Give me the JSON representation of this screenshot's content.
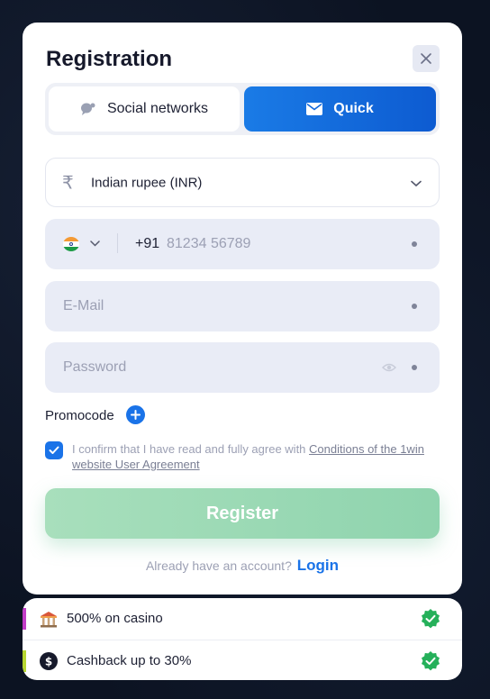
{
  "registration": {
    "title": "Registration",
    "tabs": {
      "social_label": "Social networks",
      "quick_label": "Quick"
    },
    "currency": {
      "value": "Indian rupee (INR)",
      "symbol": "₹"
    },
    "phone": {
      "code": "+91",
      "placeholder": "81234 56789"
    },
    "email": {
      "placeholder": "E-Mail"
    },
    "password": {
      "placeholder": "Password"
    },
    "promocode_label": "Promocode",
    "agreement": {
      "text": "I confirm that I have read and fully agree with ",
      "link": "Conditions of the 1win website User Agreement",
      "checked": true
    },
    "register_label": "Register",
    "login": {
      "prompt": "Already have an account?",
      "link": "Login"
    }
  },
  "bonuses": [
    {
      "label": "500% on casino",
      "icon": "casino-icon",
      "accent": "#c23cc7"
    },
    {
      "label": "Cashback up to 30%",
      "icon": "cashback-icon",
      "accent": "#b6d631"
    }
  ],
  "colors": {
    "accent_blue": "#1a73e8",
    "register_green": "#9ad9b5",
    "check_green": "#25b05a"
  }
}
